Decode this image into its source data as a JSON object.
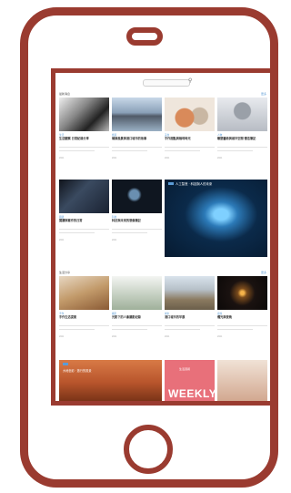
{
  "search": {
    "placeholder": ""
  },
  "sections": [
    {
      "label": "最新消息",
      "more": "更多"
    },
    {
      "label": "生活分享",
      "more": "更多"
    }
  ],
  "row1": [
    {
      "category": "生活",
      "title": "生活觀察 日常紀錄分享",
      "meta": "2021"
    },
    {
      "category": "旅遊",
      "title": "碼頭風景與港口城市的故事",
      "meta": "2021"
    },
    {
      "category": "美食",
      "title": "手作甜點與咖啡時光",
      "meta": "2021"
    },
    {
      "category": "人物",
      "title": "雕塑藝術與城市空間 慢活筆記",
      "meta": "2021"
    }
  ],
  "row2": [
    {
      "category": "閱讀",
      "title": "閱讀與寫作的日常",
      "meta": "2021"
    },
    {
      "category": "科技",
      "title": "科技與未來的想像筆記",
      "meta": "2021"
    }
  ],
  "feature": {
    "title": "人工智慧 · 科技與人的未來"
  },
  "row3": [
    {
      "category": "手作",
      "title": "手作生活提案",
      "meta": "2021"
    },
    {
      "category": "攝影",
      "title": "光影下的人像攝影紀錄",
      "meta": "2021"
    },
    {
      "category": "城市",
      "title": "港口城市的早晨",
      "meta": "2021"
    },
    {
      "category": "夜晚",
      "title": "燭光與夜晚",
      "meta": "2021"
    }
  ],
  "bottom": [
    {
      "title": "大地色彩 · 旅行的風景"
    },
    {
      "subtitle": "生活週報",
      "weekly": "WEEKLY"
    },
    {
      "title": ""
    }
  ]
}
